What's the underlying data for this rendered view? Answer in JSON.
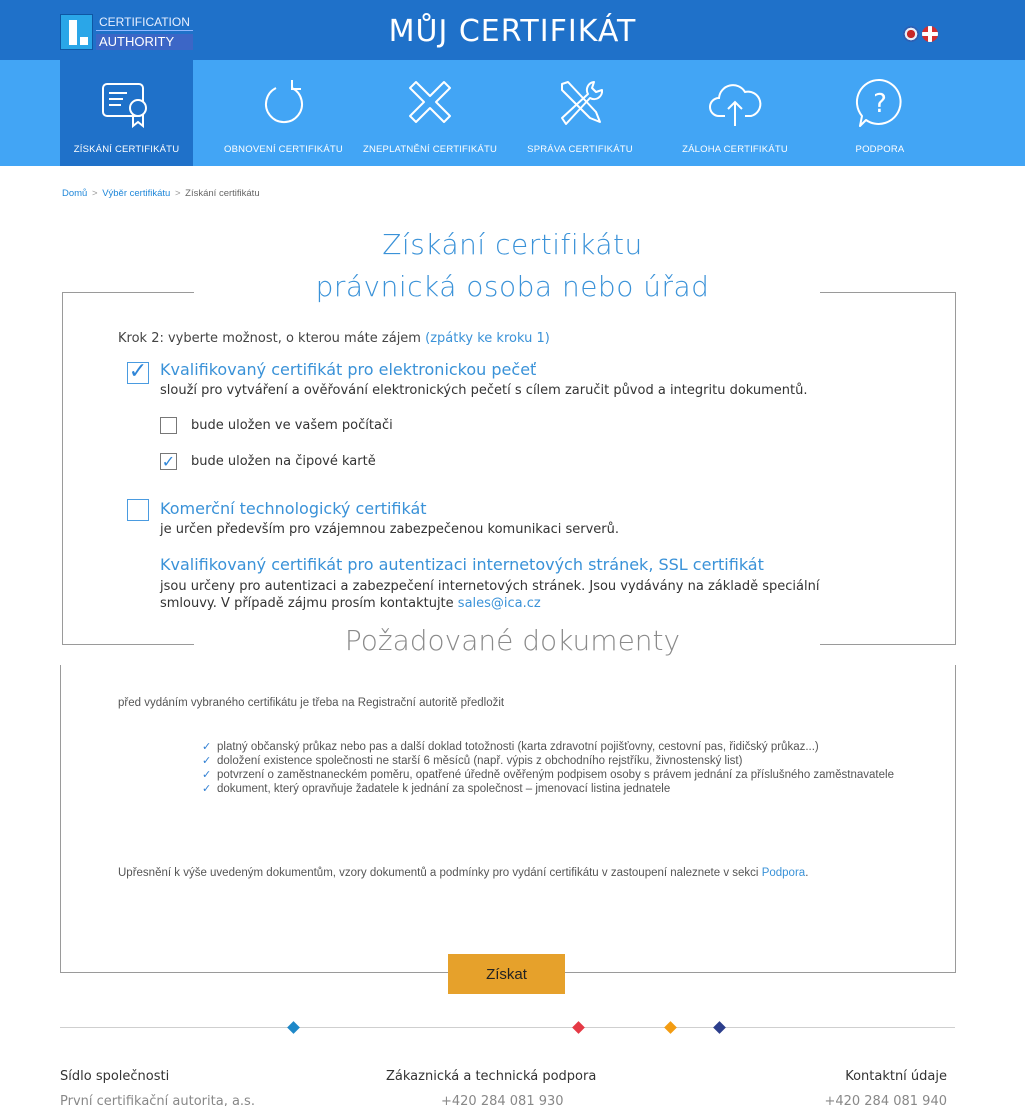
{
  "header": {
    "logo_line1": "CERTIFICATION",
    "logo_line2": "AUTHORITY",
    "title": "MŮJ CERTIFIKÁT",
    "flags": [
      "flag-cz-icon",
      "flag-en-icon"
    ]
  },
  "nav": {
    "items": [
      {
        "label": "ZÍSKÁNÍ CERTIFIKÁTU",
        "icon": "certificate-icon",
        "active": true
      },
      {
        "label": "OBNOVENÍ CERTIFIKÁTU",
        "icon": "renew-icon",
        "active": false
      },
      {
        "label": "ZNEPLATNĚNÍ CERTIFIKÁTU",
        "icon": "revoke-icon",
        "active": false
      },
      {
        "label": "SPRÁVA CERTIFIKÁTU",
        "icon": "tools-icon",
        "active": false
      },
      {
        "label": "ZÁLOHA CERTIFIKÁTU",
        "icon": "cloud-upload-icon",
        "active": false
      },
      {
        "label": "PODPORA",
        "icon": "help-icon",
        "active": false
      }
    ]
  },
  "breadcrumb": {
    "home": "Domů",
    "choose": "Výběr certifikátu",
    "current": "Získání certifikátu",
    "separator": ">"
  },
  "main": {
    "title_line1": "Získání certifikátu",
    "title_line2": "právnická osoba nebo úřad",
    "step_text": "Krok 2: vyberte možnost, o kterou máte zájem",
    "step_link": "(zpátky ke kroku 1)",
    "options": {
      "qualified_seal": {
        "checked": true,
        "title": "Kvalifikovaný certifikát pro elektronickou pečeť",
        "desc": "slouží pro vytváření a ověřování elektronických pečetí s cílem zaručit původ a integritu dokumentů.",
        "storage": [
          {
            "label": "bude uložen ve vašem počítači",
            "checked": false
          },
          {
            "label": "bude uložen na čipové kartě",
            "checked": true
          }
        ]
      },
      "commercial": {
        "checked": false,
        "title": "Komerční technologický certifikát",
        "desc": "je určen především pro vzájemnou zabezpečenou komunikaci serverů."
      },
      "ssl": {
        "title": "Kvalifikovaný certifikát pro autentizaci internetových stránek, SSL certifikát",
        "desc_line1": "jsou určeny pro autentizaci a zabezpečení internetových stránek. Jsou vydávány na základě speciální",
        "desc_line2": "smlouvy. V případě zájmu prosím kontaktujte",
        "email": "sales@ica.cz"
      }
    },
    "check_glyph": "✓"
  },
  "documents": {
    "title": "Požadované dokumenty",
    "intro": "před vydáním vybraného certifikátu je třeba na Registrační autoritě předložit",
    "items": [
      "platný občanský průkaz nebo pas a další doklad totožnosti (karta zdravotní pojišťovny, cestovní pas, řidičský průkaz...)",
      "doložení existence společnosti ne starší 6 měsíců (např. výpis z obchodního rejstříku, živnostenský list)",
      "potvrzení o zaměstnaneckém poměru, opatřené úředně ověřeným podpisem osoby s právem jednání za příslušného zaměstnavatele",
      "dokument, který opravňuje žadatele k jednání za společnost – jmenovací listina jednatele"
    ],
    "note_text": "Upřesnění k výše uvedeným dokumentům, vzory dokumentů a podmínky pro vydání certifikátu v zastoupení naleznete v sekci",
    "note_link": "Podpora",
    "note_end": "."
  },
  "actions": {
    "submit_label": "Získat"
  },
  "footer": {
    "col1_title": "Sídlo společnosti",
    "col1_value": "První certifikační autorita, a.s.",
    "col2_title": "Zákaznická a technická podpora",
    "col2_value": "+420 284 081 930",
    "col3_title": "Kontaktní údaje",
    "col3_value": "+420 284 081 940",
    "accent_colors": [
      "#1e88c8",
      "#e53945",
      "#f39c12",
      "#2c3e8c"
    ]
  },
  "colors": {
    "header_bg": "#1f71c9",
    "nav_bg": "#42a5f5",
    "accent": "#3a92d8",
    "button": "#e6a12b"
  }
}
